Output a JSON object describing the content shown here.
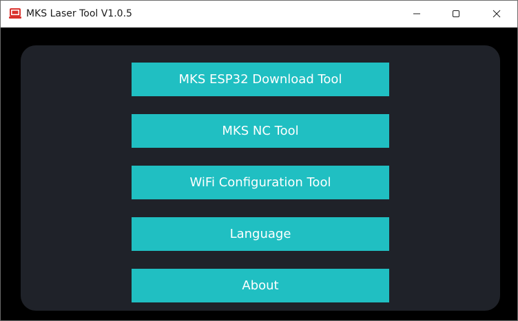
{
  "window": {
    "title": "MKS Laser Tool V1.0.5",
    "controls": {
      "minimize_icon": "minimize-icon",
      "maximize_icon": "maximize-icon",
      "close_icon": "close-icon"
    },
    "app_icon": "laptop-icon"
  },
  "menu": {
    "buttons": [
      {
        "label": "MKS ESP32 Download Tool"
      },
      {
        "label": "MKS NC Tool"
      },
      {
        "label": "WiFi Configuration Tool"
      },
      {
        "label": "Language"
      },
      {
        "label": "About"
      }
    ]
  },
  "colors": {
    "accent": "#20bfc2",
    "panel": "#1f2229",
    "background": "#000000",
    "app_icon": "#d9302b"
  }
}
